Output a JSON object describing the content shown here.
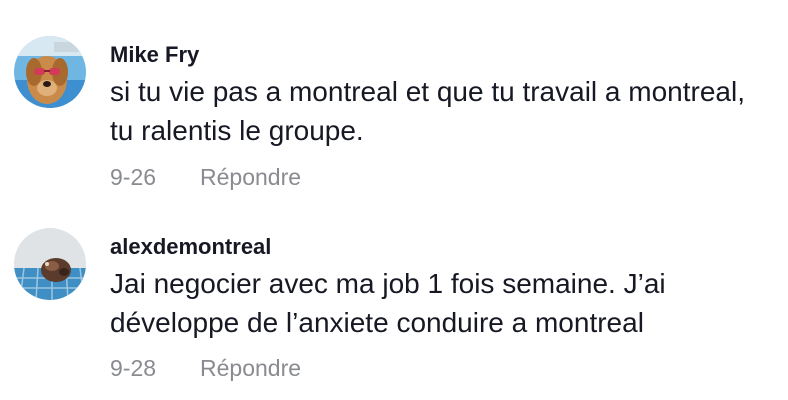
{
  "comments": [
    {
      "username": "Mike Fry",
      "avatar_icon": "dog-with-goggles-avatar",
      "lines": [
        "si tu vie pas a montreal et que tu travail a montreal,",
        "tu ralentis le groupe."
      ],
      "date": "9-26",
      "reply_label": "Répondre"
    },
    {
      "username": "alexdemontreal",
      "avatar_icon": "animal-on-blue-tiles-avatar",
      "lines": [
        "Jai negocier avec ma job 1 fois semaine. J’ai",
        "développe de l’anxiete conduire a montreal"
      ],
      "date": "9-28",
      "reply_label": "Répondre"
    }
  ],
  "colors": {
    "username": "#161823",
    "text": "#161823",
    "meta": "#8a8b91"
  }
}
